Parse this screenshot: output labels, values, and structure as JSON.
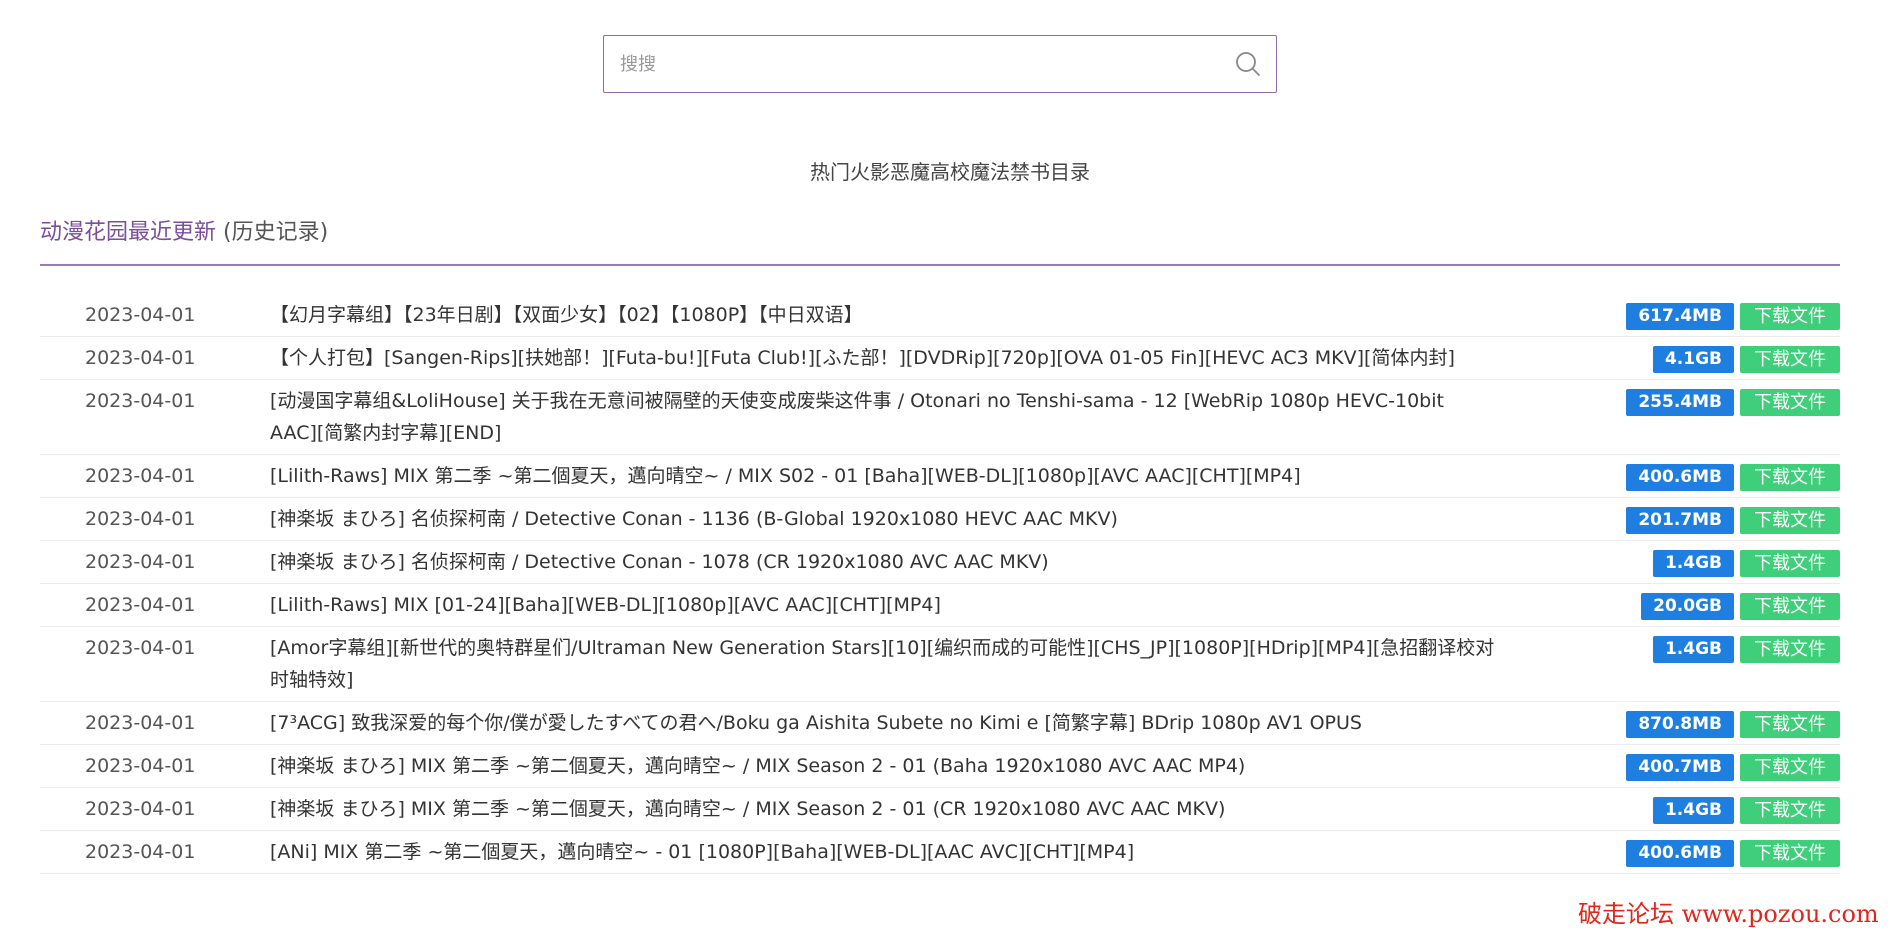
{
  "search": {
    "placeholder": "搜搜"
  },
  "hot": {
    "links": [
      "热门",
      "火影",
      "恶魔高校",
      "魔法禁书目录"
    ]
  },
  "section": {
    "title": "动漫花园最近更新",
    "history": "(历史记录)"
  },
  "download_label": "下载文件",
  "items": [
    {
      "date": "2023-04-01",
      "title": "【幻月字幕组】【23年日剧】【双面少女】【02】【1080P】【中日双语】",
      "size": "617.4MB"
    },
    {
      "date": "2023-04-01",
      "title": "【个人打包】[Sangen-Rips][扶她部！][Futa-bu!][Futa Club!][ふた部！][DVDRip][720p][OVA 01-05 Fin][HEVC AC3 MKV][简体内封]",
      "size": "4.1GB"
    },
    {
      "date": "2023-04-01",
      "title": "[动漫国字幕组&LoliHouse] 关于我在无意间被隔壁的天使变成废柴这件事 / Otonari no Tenshi-sama - 12 [WebRip 1080p HEVC-10bit AAC][简繁内封字幕][END]",
      "size": "255.4MB"
    },
    {
      "date": "2023-04-01",
      "title": "[Lilith-Raws] MIX 第二季 ~第二個夏天，邁向晴空~ / MIX S02 - 01 [Baha][WEB-DL][1080p][AVC AAC][CHT][MP4]",
      "size": "400.6MB"
    },
    {
      "date": "2023-04-01",
      "title": "[神楽坂 まひろ] 名侦探柯南 / Detective Conan - 1136 (B-Global 1920x1080 HEVC AAC MKV)",
      "size": "201.7MB"
    },
    {
      "date": "2023-04-01",
      "title": "[神楽坂 まひろ] 名侦探柯南 / Detective Conan - 1078 (CR 1920x1080 AVC AAC MKV)",
      "size": "1.4GB"
    },
    {
      "date": "2023-04-01",
      "title": "[Lilith-Raws] MIX [01-24][Baha][WEB-DL][1080p][AVC AAC][CHT][MP4]",
      "size": "20.0GB"
    },
    {
      "date": "2023-04-01",
      "title": "[Amor字幕组][新世代的奥特群星们/Ultraman New Generation Stars][10][编织而成的可能性][CHS_JP][1080P][HDrip][MP4][急招翻译校对时轴特效]",
      "size": "1.4GB"
    },
    {
      "date": "2023-04-01",
      "title": "[7³ACG] 致我深爱的每个你/僕が愛したすべての君へ/Boku ga Aishita Subete no Kimi e [简繁字幕] BDrip 1080p AV1 OPUS",
      "size": "870.8MB"
    },
    {
      "date": "2023-04-01",
      "title": "[神楽坂 まひろ] MIX 第二季 ~第二個夏天，邁向晴空~ / MIX Season 2 - 01 (Baha 1920x1080 AVC AAC MP4)",
      "size": "400.7MB"
    },
    {
      "date": "2023-04-01",
      "title": "[神楽坂 まひろ] MIX 第二季 ~第二個夏天，邁向晴空~ / MIX Season 2 - 01 (CR 1920x1080 AVC AAC MKV)",
      "size": "1.4GB"
    },
    {
      "date": "2023-04-01",
      "title": "[ANi] MIX 第二季 ~第二個夏天，邁向晴空~ - 01 [1080P][Baha][WEB-DL][AAC AVC][CHT][MP4]",
      "size": "400.6MB"
    }
  ],
  "watermark": "破走论坛 www.pozou.com",
  "colors": {
    "accent": "#7a4e9a",
    "size_badge": "#1e7fe0",
    "download": "#3fcf7a",
    "watermark": "#e0261a"
  }
}
